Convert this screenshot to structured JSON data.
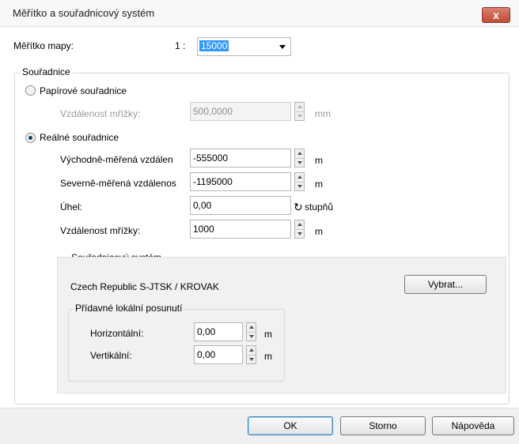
{
  "window": {
    "title": "Měřítko a souřadnicový systém",
    "close_label": "x"
  },
  "scale": {
    "label": "Měřítko mapy:",
    "prefix": "1 :",
    "value": "15000"
  },
  "coords": {
    "legend": "Souřadnice",
    "paper": {
      "label": "Papírové souřadnice",
      "selected": false,
      "grid_label": "Vzdálenost mřížky:",
      "grid_value": "500,0000",
      "grid_unit": "mm"
    },
    "real": {
      "label": "Reálné souřadnice",
      "selected": true,
      "easting_label": "Východně-měřená vzdálen",
      "easting_value": "-555000",
      "easting_unit": "m",
      "northing_label": "Severně-měřená vzdálenos",
      "northing_value": "-1195000",
      "northing_unit": "m",
      "angle_label": "Úhel:",
      "angle_value": "0,00",
      "angle_unit": "stupňů",
      "grid_label": "Vzdálenost mřížky:",
      "grid_value": "1000",
      "grid_unit": "m"
    }
  },
  "system": {
    "legend": "Souřadnicový systém",
    "name": "Czech Republic  S-JTSK / KROVAK",
    "select_button": "Vybrat...",
    "offset": {
      "legend": "Přídavné lokální posunutí",
      "horizontal_label": "Horizontální:",
      "horizontal_value": "0,00",
      "horizontal_unit": "m",
      "vertical_label": "Vertikální:",
      "vertical_value": "0,00",
      "vertical_unit": "m"
    }
  },
  "buttons": {
    "ok": "OK",
    "cancel": "Storno",
    "help": "Nápověda"
  },
  "icons": {
    "rotate": "rotate-icon",
    "close": "close-icon",
    "dropdown": "chevron-down-icon"
  },
  "colors": {
    "selection": "#3399ff",
    "close_button": "#c9563f"
  }
}
